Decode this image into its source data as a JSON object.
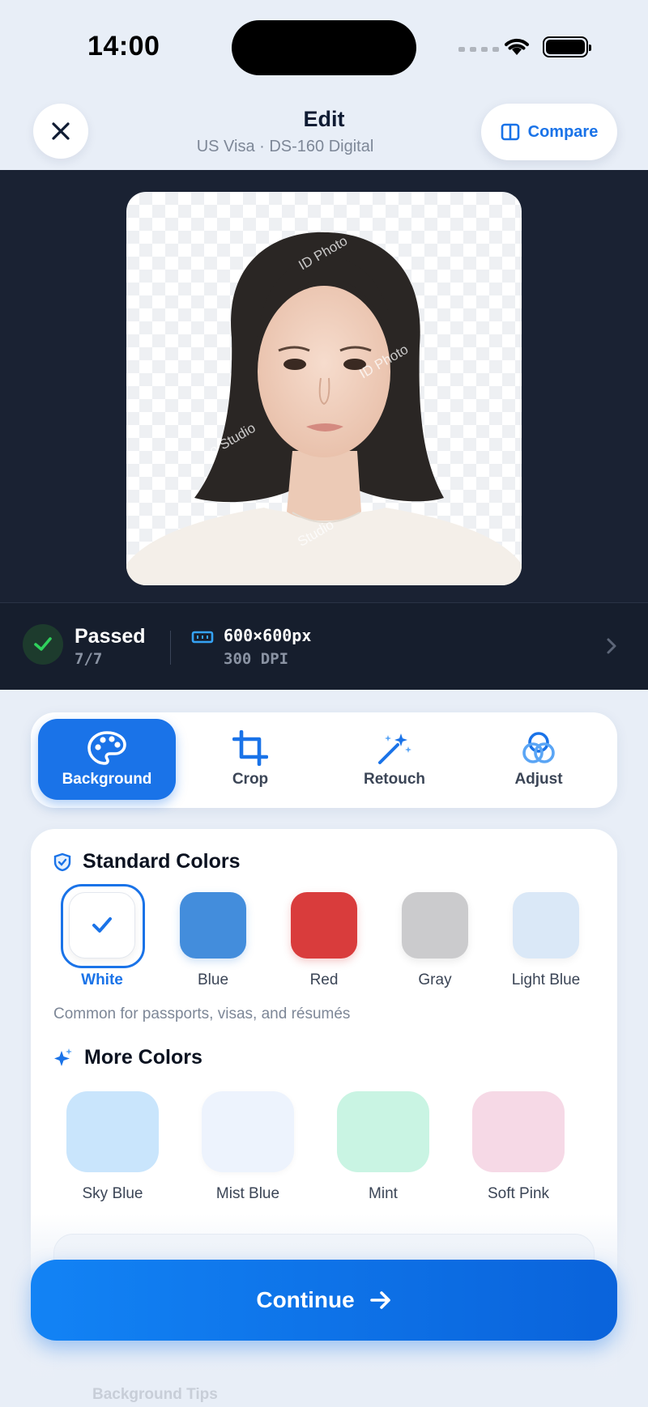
{
  "status_bar": {
    "time": "14:00"
  },
  "header": {
    "title": "Edit",
    "subtitle": "US Visa · DS-160 Digital",
    "compare_label": "Compare"
  },
  "photo": {
    "watermark": [
      "ID Photo",
      "ID Photo",
      "o Studio",
      "Studio"
    ]
  },
  "info": {
    "status": "Passed",
    "checks": "7/7",
    "dimensions": "600×600px",
    "dpi": "300 DPI"
  },
  "tabs": [
    {
      "label": "Background",
      "icon": "palette-icon",
      "active": true
    },
    {
      "label": "Crop",
      "icon": "crop-icon",
      "active": false
    },
    {
      "label": "Retouch",
      "icon": "magic-wand-icon",
      "active": false
    },
    {
      "label": "Adjust",
      "icon": "adjust-circles-icon",
      "active": false
    }
  ],
  "standard": {
    "title": "Standard Colors",
    "hint": "Common for passports, visas, and résumés",
    "colors": [
      {
        "label": "White",
        "color": "#ffffff",
        "selected": true
      },
      {
        "label": "Blue",
        "color": "#438ddc"
      },
      {
        "label": "Red",
        "color": "#d93c3c"
      },
      {
        "label": "Gray",
        "color": "#cbcbcd"
      },
      {
        "label": "Light Blue",
        "color": "#dae8f7"
      }
    ]
  },
  "more": {
    "title": "More Colors",
    "colors": [
      {
        "label": "Sky Blue",
        "color": "#c9e5fc"
      },
      {
        "label": "Mist Blue",
        "color": "#edf3fd"
      },
      {
        "label": "Mint",
        "color": "#c9f4e3"
      },
      {
        "label": "Soft Pink",
        "color": "#f6d9e6"
      }
    ]
  },
  "tips": {
    "title": "Background Tips"
  },
  "cta": {
    "label": "Continue"
  },
  "colors": {
    "accent": "#1a73e8",
    "canvas_bg": "#1a2233",
    "pass_green": "#2fd15c"
  }
}
